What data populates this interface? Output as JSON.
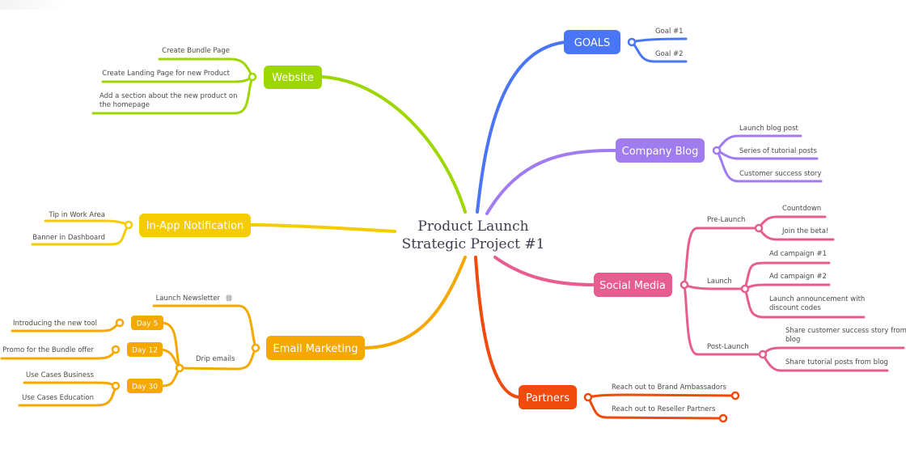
{
  "root": {
    "line1": "Product Launch",
    "line2": "Strategic Project #1"
  },
  "colors": {
    "goals": "#4a76f5",
    "blog": "#a07cf0",
    "social": "#e85d8f",
    "partners": "#f04a0c",
    "email": "#f5a800",
    "inapp": "#f5cc00",
    "website": "#9ed600"
  },
  "branches": {
    "goals": {
      "label": "GOALS",
      "children": [
        "Goal #1",
        "Goal #2"
      ]
    },
    "blog": {
      "label": "Company Blog",
      "children": [
        "Launch blog post",
        "Series of tutorial posts",
        "Customer success story"
      ]
    },
    "social": {
      "label": "Social Media",
      "groups": [
        {
          "label": "Pre-Launch",
          "children": [
            "Countdown",
            "Join the beta!"
          ]
        },
        {
          "label": "Launch",
          "children": [
            "Ad campaign #1",
            "Ad campaign #2",
            "Launch announcement with",
            "discount codes"
          ]
        },
        {
          "label": "Post-Launch",
          "children": [
            "Share customer success story from",
            "blog",
            "Share tutorial posts from blog"
          ]
        }
      ]
    },
    "partners": {
      "label": "Partners",
      "children": [
        "Reach out to Brand Ambassadors",
        "Reach out to Reseller Partners"
      ]
    },
    "website": {
      "label": "Website",
      "children": [
        "Create Bundle Page",
        "Create Landing Page for new Product",
        "Add a section about the new product on",
        "the homepage"
      ]
    },
    "inapp": {
      "label": "In-App Notification",
      "children": [
        "Tip in Work Area",
        "Banner in Dashboard"
      ]
    },
    "email": {
      "label": "Email Marketing",
      "newsletter": "Launch Newsletter",
      "drip": "Drip emails",
      "days": [
        {
          "label": "Day 5",
          "children": [
            "Introducing the new tool"
          ]
        },
        {
          "label": "Day 12",
          "children": [
            "Promo for the Bundle offer"
          ]
        },
        {
          "label": "Day 30",
          "children": [
            "Use Cases Business",
            "Use Cases Education"
          ]
        }
      ]
    }
  }
}
